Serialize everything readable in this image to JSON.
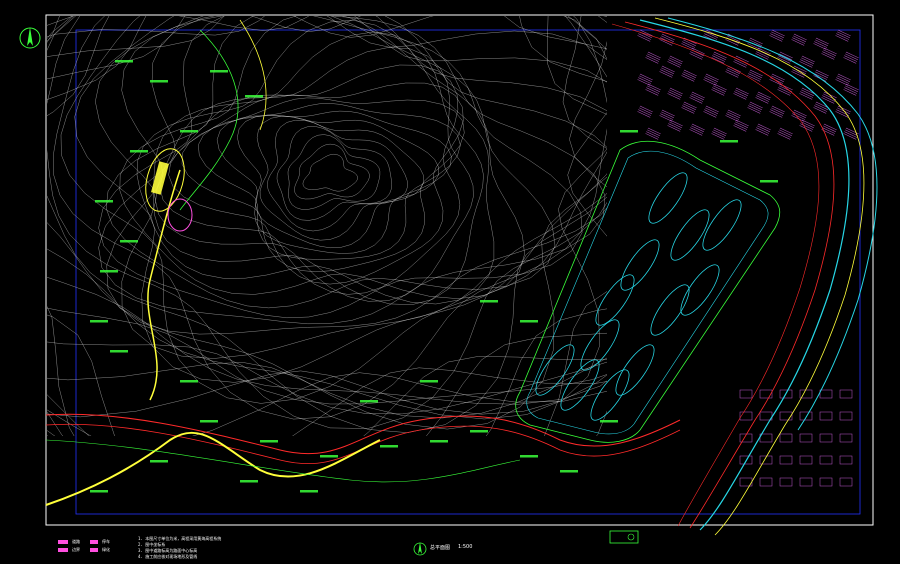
{
  "drawing": {
    "scale_label": "1:500",
    "title_caption": "总平面图",
    "legend": {
      "items": [
        {
          "label": "道路",
          "color": "#ff4fe0"
        },
        {
          "label": "边界",
          "color": "#ff4fe0"
        },
        {
          "label": "停车",
          "color": "#ff4fe0"
        },
        {
          "label": "绿化",
          "color": "#ff4fe0"
        }
      ],
      "notes": [
        "1. 本图尺寸单位为米，高程采用黄海高程系统",
        "2. 图中坐标系",
        "3. 图中道路标高为路面中心标高",
        "4. 施工前应核对现场地形及管线"
      ]
    },
    "colors": {
      "background": "#000000",
      "frame": "#ffffff",
      "inner_frame": "#2233ff",
      "contour": "#e8e8e8",
      "parking": "#27d7e6",
      "labels": "#39ff3a",
      "road_red": "#ff2a2a",
      "road_yellow": "#ffff3a",
      "buildings": "#c05ad0",
      "boundary": "#3b3bff"
    },
    "icons": [
      "north-arrow-icon",
      "title-north-arrow-icon",
      "stamp-icon"
    ]
  }
}
